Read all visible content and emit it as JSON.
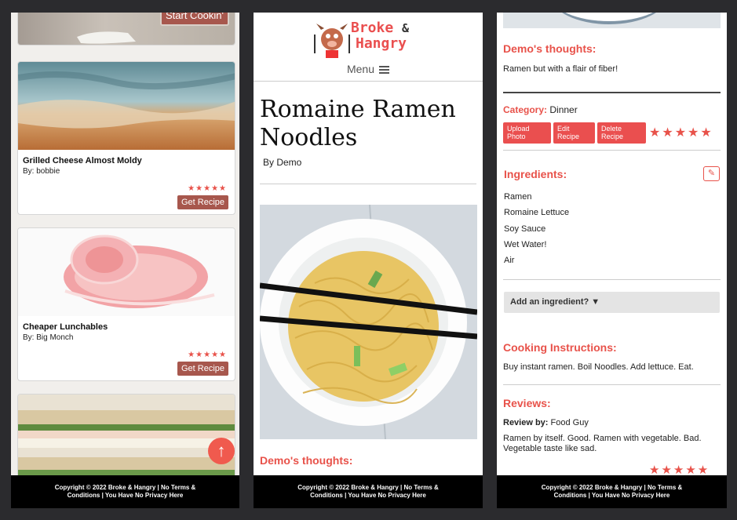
{
  "panel1": {
    "start_button": "Start Cookin'",
    "cards": [
      {
        "title": "Grilled Cheese Almost Moldy",
        "by": "By: bobbie",
        "stars": "★★★★★",
        "button": "Get Recipe"
      },
      {
        "title": "Cheaper Lunchables",
        "by": "By: Big Monch",
        "stars": "★★★★★",
        "button": "Get Recipe"
      }
    ],
    "up_icon": "arrow-up-icon"
  },
  "panel2": {
    "logo": {
      "line1": "Broke",
      "amp": "&",
      "line2": "Hangry"
    },
    "menu_label": "Menu",
    "title": "Romaine Ramen Noodles",
    "by": "By Demo",
    "thoughts_heading": "Demo's thoughts:"
  },
  "panel3": {
    "thoughts_heading": "Demo's thoughts:",
    "thoughts_text": "Ramen but with a flair of fiber!",
    "category_label": "Category:",
    "category_value": "Dinner",
    "buttons": {
      "upload": "Upload Photo",
      "edit": "Edit Recipe",
      "delete": "Delete Recipe"
    },
    "rating_stars": "★★★★★",
    "ingredients_heading": "Ingredients:",
    "ingredients": [
      "Ramen",
      "Romaine Lettuce",
      "Soy Sauce",
      "Wet Water!",
      "Air"
    ],
    "add_ingredient": "Add an ingredient? ▼",
    "instructions_heading": "Cooking Instructions:",
    "instructions_text": "Buy instant ramen. Boil Noodles. Add lettuce. Eat.",
    "reviews_heading": "Reviews:",
    "review_by_label": "Review by:",
    "review_by_name": "Food Guy",
    "review_text": "Ramen by itself. Good. Ramen with vegetable. Bad. Vegetable taste like sad.",
    "review_stars": "★★★★★"
  },
  "footer": {
    "line1": "Copyright © 2022 Broke & Hangry | No Terms &",
    "line2": "Conditions | You Have No Privacy Here"
  },
  "colors": {
    "accent": "#e8524a",
    "button_brown": "#a7574d",
    "footer_bg": "#000000",
    "page_bg": "#2b2b2e"
  }
}
